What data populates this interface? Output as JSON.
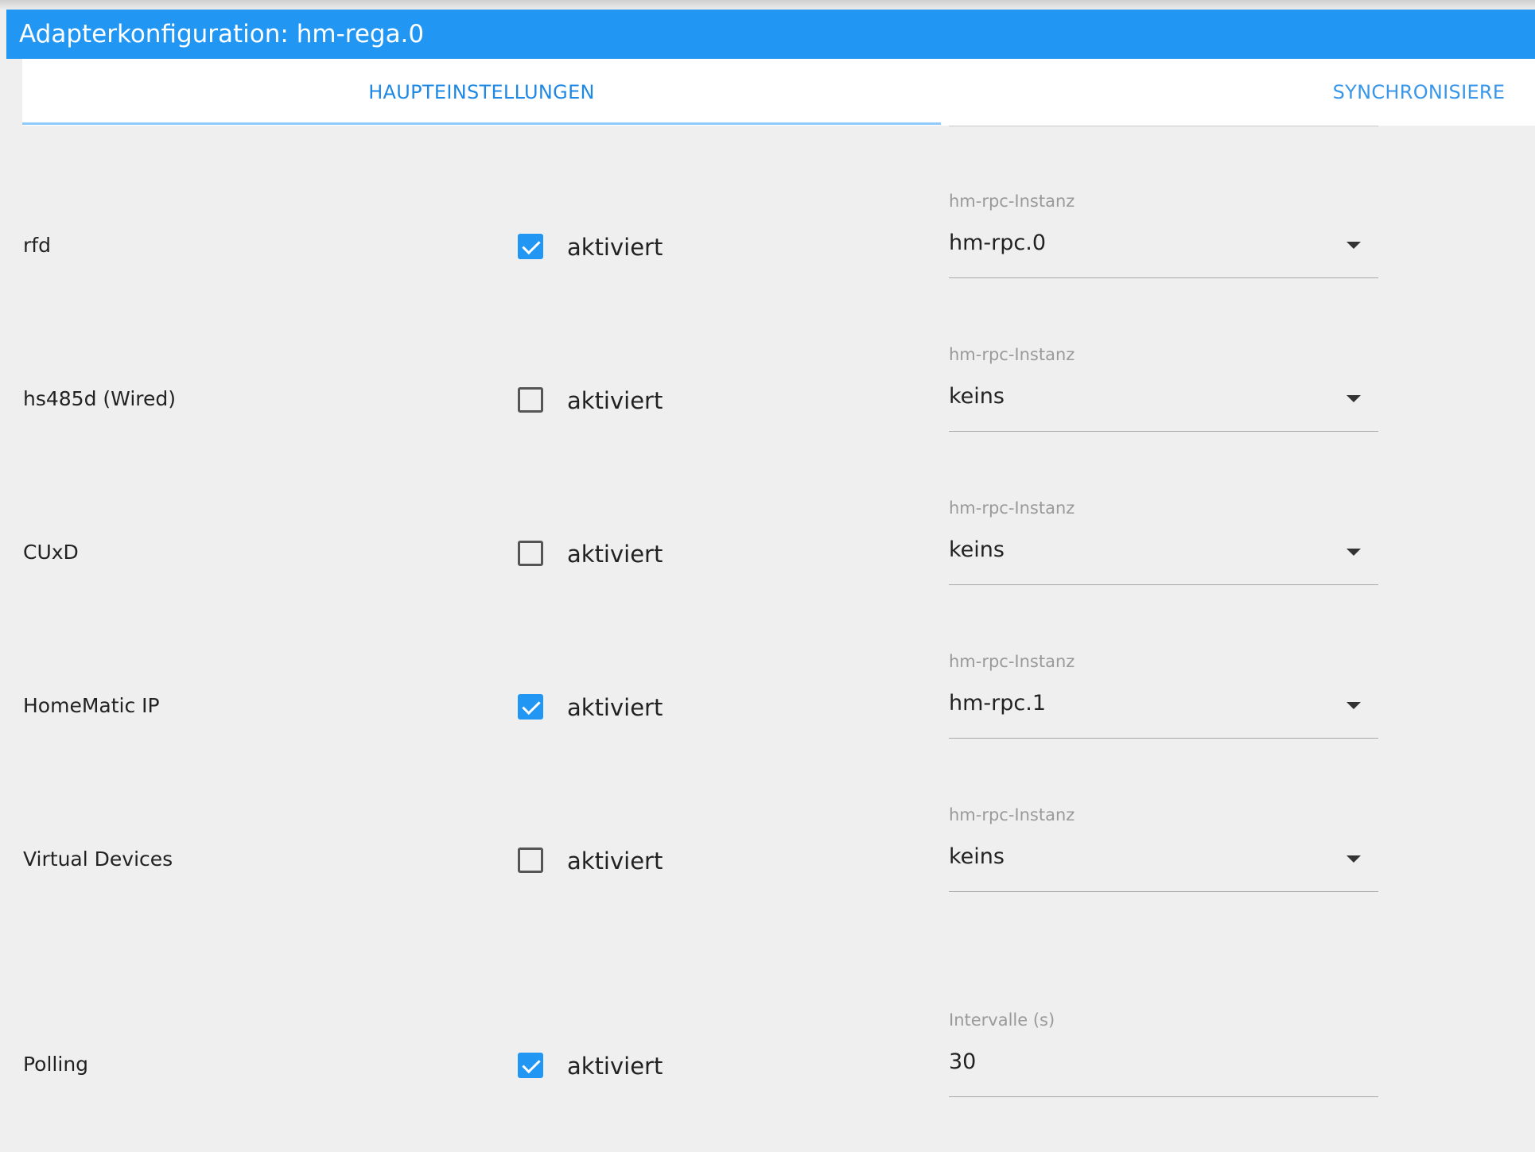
{
  "window": {
    "title": "Adapterkonfiguration: hm-rega.0"
  },
  "tabs": [
    {
      "label": "HAUPTEINSTELLUNGEN",
      "active": true
    },
    {
      "label": "SYNCHRONISIERE",
      "active": false
    }
  ],
  "checkbox_label": "aktiviert",
  "rows": [
    {
      "name": "rfd",
      "checked": true,
      "field_label": "hm-rpc-Instanz",
      "value": "hm-rpc.0",
      "type": "select"
    },
    {
      "name": "hs485d (Wired)",
      "checked": false,
      "field_label": "hm-rpc-Instanz",
      "value": "keins",
      "type": "select"
    },
    {
      "name": "CUxD",
      "checked": false,
      "field_label": "hm-rpc-Instanz",
      "value": "keins",
      "type": "select"
    },
    {
      "name": "HomeMatic IP",
      "checked": true,
      "field_label": "hm-rpc-Instanz",
      "value": "hm-rpc.1",
      "type": "select"
    },
    {
      "name": "Virtual Devices",
      "checked": false,
      "field_label": "hm-rpc-Instanz",
      "value": "keins",
      "type": "select"
    },
    {
      "name": "Polling",
      "checked": true,
      "field_label": "Intervalle (s)",
      "value": "30",
      "type": "input"
    }
  ],
  "colors": {
    "accent": "#2196f3",
    "background": "#efefef",
    "tab_text": "#1e88e5"
  }
}
